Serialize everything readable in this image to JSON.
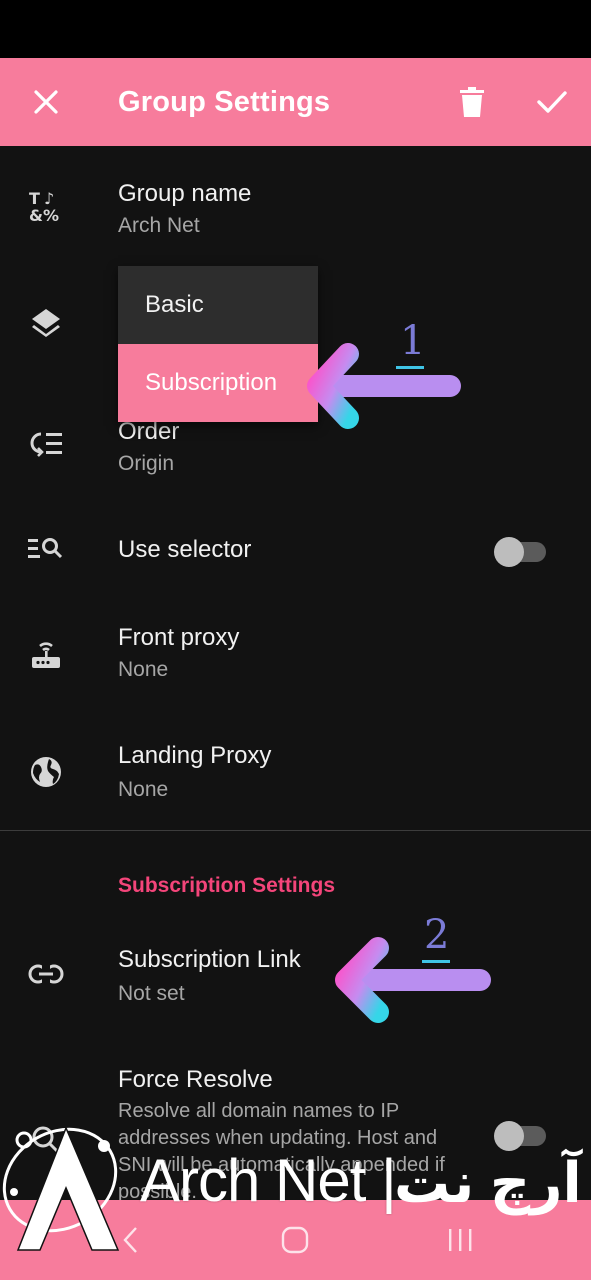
{
  "toolbar": {
    "title": "Group Settings",
    "close_icon": "close-icon",
    "delete_icon": "trash-icon",
    "confirm_icon": "check-icon"
  },
  "settings": {
    "group_name": {
      "title": "Group name",
      "value": "Arch Net",
      "icon": "text-format-icon"
    },
    "type": {
      "icon": "layers-icon"
    },
    "order": {
      "title": "Order",
      "value": "Origin",
      "icon": "sort-icon"
    },
    "use_selector": {
      "title": "Use selector",
      "icon": "list-search-icon",
      "enabled": false
    },
    "front_proxy": {
      "title": "Front proxy",
      "value": "None",
      "icon": "router-icon"
    },
    "landing_proxy": {
      "title": "Landing Proxy",
      "value": "None",
      "icon": "globe-icon"
    }
  },
  "subscription": {
    "section_title": "Subscription Settings",
    "link": {
      "title": "Subscription Link",
      "value": "Not set",
      "icon": "link-icon"
    },
    "force_resolve": {
      "title": "Force Resolve",
      "description": "Resolve all domain names to IP addresses when updating. Host and SNI will be automatically appended if possible.",
      "enabled": false
    }
  },
  "type_menu": {
    "options": [
      "Basic",
      "Subscription"
    ],
    "selected": "Subscription"
  },
  "annotations": {
    "first": "1",
    "second": "2"
  },
  "watermark": {
    "brand": "Arch Net",
    "separator": "|",
    "brand_fa": "آرچ نت"
  },
  "colors": {
    "accent": "#f77c9c",
    "section": "#f4457a",
    "background": "#121212"
  }
}
